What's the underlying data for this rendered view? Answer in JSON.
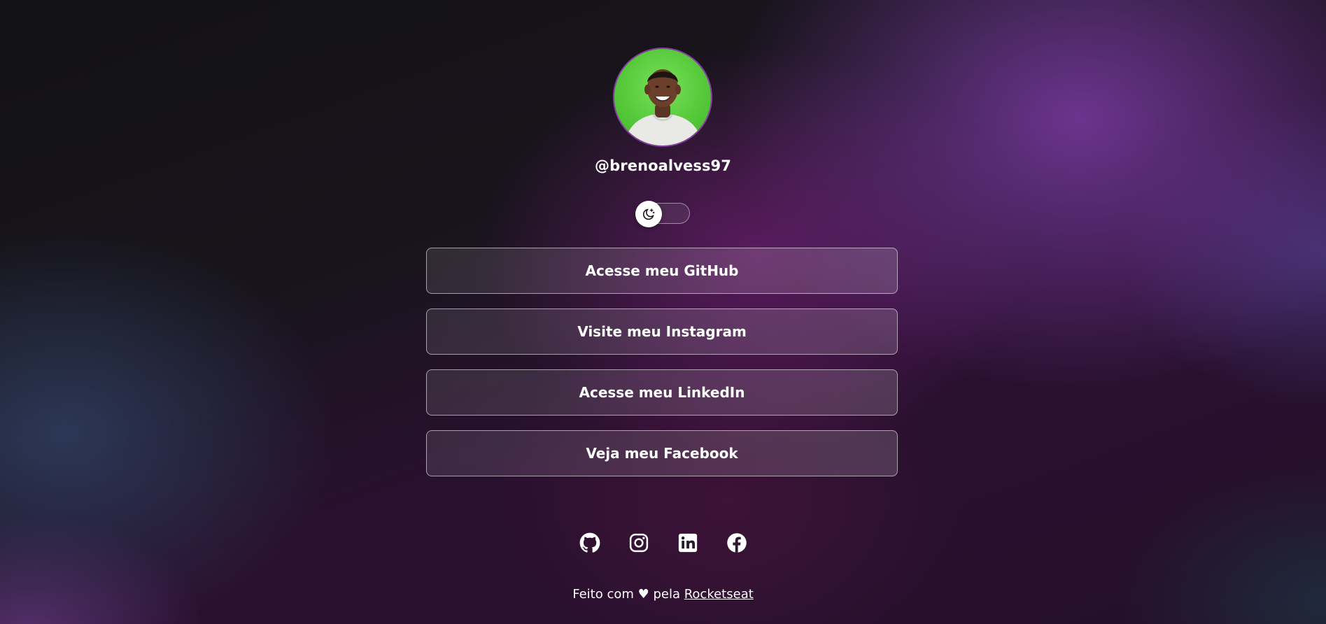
{
  "profile": {
    "username": "@brenoalvess97",
    "avatar_icon": "profile-photo"
  },
  "theme_toggle": {
    "icon": "moon-icon",
    "state": "dark"
  },
  "links": [
    {
      "label": "Acesse meu GitHub"
    },
    {
      "label": "Visite meu Instagram"
    },
    {
      "label": "Acesse meu LinkedIn"
    },
    {
      "label": "Veja meu Facebook"
    }
  ],
  "socials": [
    {
      "icon": "github-icon"
    },
    {
      "icon": "instagram-icon"
    },
    {
      "icon": "linkedin-icon"
    },
    {
      "icon": "facebook-icon"
    }
  ],
  "footer": {
    "text_before": "Feito com ♥ pela ",
    "link_label": "Rocketseat"
  },
  "colors": {
    "accent_border": "#8a3ea5",
    "avatar_bg": "#55c93a",
    "text": "#ffffff"
  }
}
